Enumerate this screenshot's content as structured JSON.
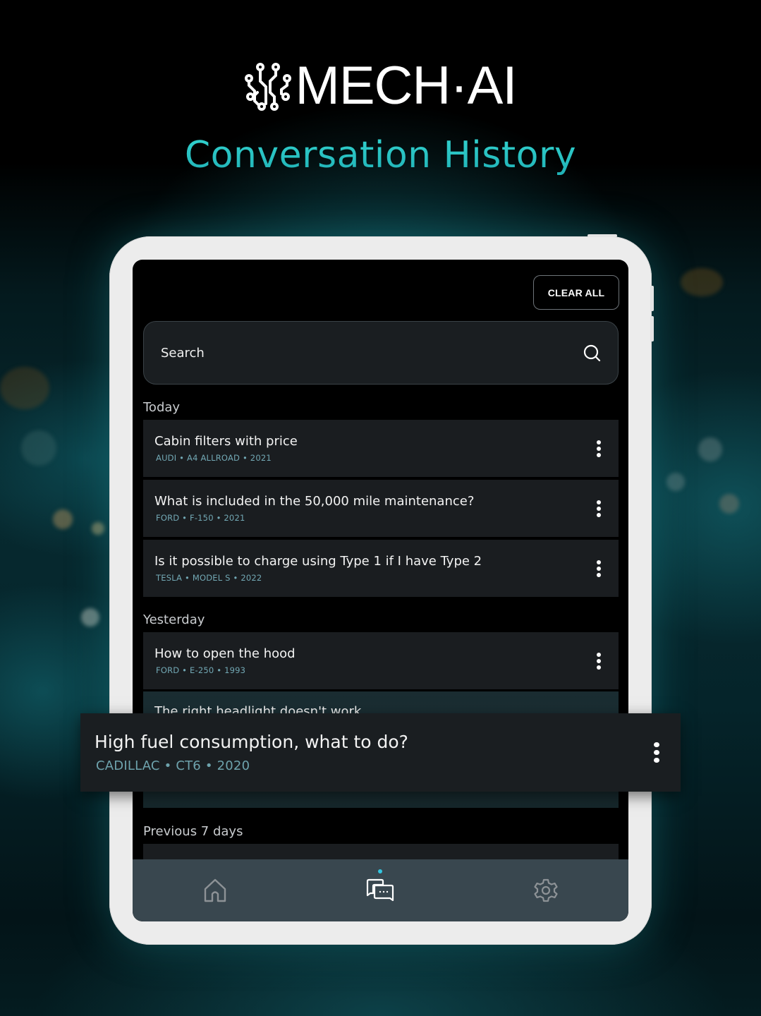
{
  "brand": {
    "name": "MECH·AI",
    "logo_icon": "circuit-brain-icon"
  },
  "headline": "Conversation History",
  "colors": {
    "accent": "#2bc6c6",
    "meta_text": "#72a8b4",
    "nav_bg": "#39474f",
    "active_dot": "#33c5e0",
    "card_bg": "#1a1d20"
  },
  "toolbar": {
    "clear_all_label": "CLEAR ALL"
  },
  "search": {
    "placeholder": "Search",
    "value": "",
    "icon": "search-icon"
  },
  "sections": [
    {
      "label": "Today",
      "items": [
        {
          "title": "Cabin filters with price",
          "meta": "AUDI • A4 ALLROAD • 2021"
        },
        {
          "title": "What is included in the 50,000 mile maintenance?",
          "meta": "FORD • F-150 • 2021"
        },
        {
          "title": "Is it possible to charge using Type 1 if I have Type 2",
          "meta": "TESLA • MODEL S • 2022"
        }
      ]
    },
    {
      "label": "Yesterday",
      "items": [
        {
          "title": "How to open the hood",
          "meta": "FORD • E-250 • 1993"
        },
        {
          "title": "The right headlight doesn't work",
          "meta": ""
        }
      ]
    },
    {
      "label": "Previous 7 days",
      "items": []
    }
  ],
  "highlighted_item": {
    "title": "High fuel consumption, what to do?",
    "meta": "CADILLAC • CT6 • 2020"
  },
  "nav": {
    "items": [
      {
        "name": "home",
        "icon": "home-icon",
        "active": false
      },
      {
        "name": "conversations",
        "icon": "chat-bubbles-icon",
        "active": true
      },
      {
        "name": "settings",
        "icon": "gear-icon",
        "active": false
      }
    ]
  }
}
